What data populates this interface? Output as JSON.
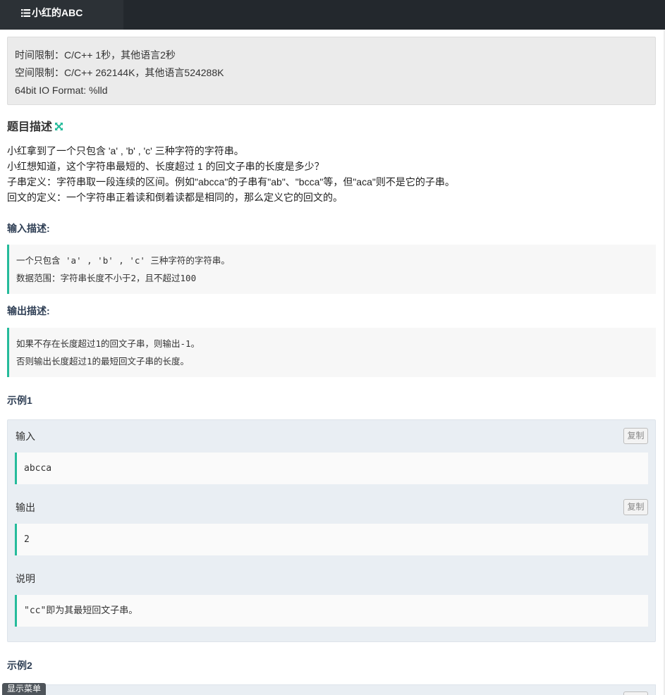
{
  "tab": {
    "title": "小红的ABC"
  },
  "limits": {
    "time": "时间限制：C/C++ 1秒，其他语言2秒",
    "space": "空间限制：C/C++ 262144K，其他语言524288K",
    "io": "64bit IO Format: %lld"
  },
  "description": {
    "title": "题目描述",
    "lines": [
      "小红拿到了一个只包含 'a' , 'b' , 'c' 三种字符的字符串。",
      "小红想知道，这个字符串最短的、长度超过 1 的回文子串的长度是多少？",
      "子串定义：字符串取一段连续的区间。例如\"abcca\"的子串有\"ab\"、\"bcca\"等，但\"aca\"则不是它的子串。",
      "回文的定义：一个字符串正着读和倒着读都是相同的，那么定义它的回文的。"
    ]
  },
  "input_desc": {
    "title": "输入描述:",
    "lines": [
      "一个只包含 'a' , 'b' , 'c' 三种字符的字符串。",
      "数据范围：字符串长度不小于2，且不超过100"
    ]
  },
  "output_desc": {
    "title": "输出描述:",
    "lines": [
      "如果不存在长度超过1的回文子串，则输出-1。",
      "否则输出长度超过1的最短回文子串的长度。"
    ]
  },
  "example1": {
    "title": "示例1",
    "input_label": "输入",
    "input_value": "abcca",
    "output_label": "输出",
    "output_value": "2",
    "note_label": "说明",
    "note_value": "\"cc\"即为其最短回文子串。",
    "copy_label": "复制"
  },
  "example2": {
    "title": "示例2"
  },
  "menu_button": "显示菜单",
  "colors": {
    "accent": "#25bb9b",
    "topbar": "#23282d"
  }
}
